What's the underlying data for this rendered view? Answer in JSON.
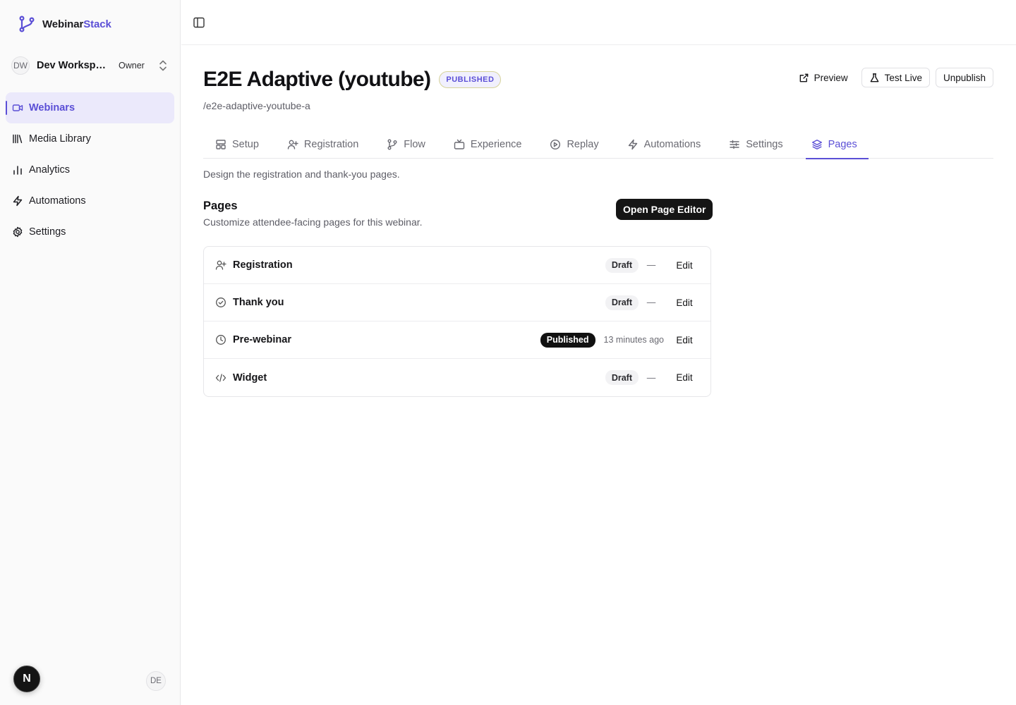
{
  "brand": {
    "name_main": "Webinar",
    "name_accent": "Stack",
    "accent_color": "#5b4fd6"
  },
  "workspace": {
    "initials": "DW",
    "name": "Dev Workspa...",
    "role": "Owner"
  },
  "sidebar": {
    "items": [
      {
        "label": "Webinars",
        "icon": "video-icon",
        "active": true
      },
      {
        "label": "Media Library",
        "icon": "library-icon"
      },
      {
        "label": "Analytics",
        "icon": "bar-chart-icon"
      },
      {
        "label": "Automations",
        "icon": "zap-icon"
      },
      {
        "label": "Settings",
        "icon": "gear-icon"
      }
    ]
  },
  "footer": {
    "dev_badge": "N",
    "user_initials": "DE"
  },
  "header": {
    "title": "E2E Adaptive (youtube)",
    "status": "PUBLISHED",
    "slug": "/e2e-adaptive-youtube-a",
    "actions": {
      "preview": "Preview",
      "test_live": "Test Live",
      "unpublish": "Unpublish"
    }
  },
  "tabs": [
    {
      "label": "Setup",
      "icon": "layout-icon"
    },
    {
      "label": "Registration",
      "icon": "user-plus-icon"
    },
    {
      "label": "Flow",
      "icon": "git-branch-icon"
    },
    {
      "label": "Experience",
      "icon": "tv-icon"
    },
    {
      "label": "Replay",
      "icon": "play-circle-icon"
    },
    {
      "label": "Automations",
      "icon": "zap-icon"
    },
    {
      "label": "Settings",
      "icon": "sliders-icon"
    },
    {
      "label": "Pages",
      "icon": "layers-icon",
      "active": true
    }
  ],
  "tab_description": "Design the registration and thank-you pages.",
  "pages_section": {
    "title": "Pages",
    "subtitle": "Customize attendee-facing pages for this webinar.",
    "open_editor": "Open Page Editor",
    "rows": [
      {
        "name": "Registration",
        "icon": "user-plus-icon",
        "status": "Draft",
        "updated": "—",
        "action": "Edit"
      },
      {
        "name": "Thank you",
        "icon": "check-circle-icon",
        "status": "Draft",
        "updated": "—",
        "action": "Edit"
      },
      {
        "name": "Pre-webinar",
        "icon": "clock-icon",
        "status": "Published",
        "updated": "13 minutes ago",
        "action": "Edit"
      },
      {
        "name": "Widget",
        "icon": "code-icon",
        "status": "Draft",
        "updated": "—",
        "action": "Edit"
      }
    ]
  }
}
